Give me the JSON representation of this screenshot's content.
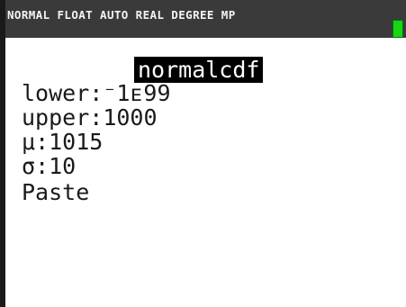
{
  "status_bar": {
    "text": "NORMAL FLOAT AUTO REAL DEGREE MP",
    "battery_color": "#16d616",
    "background_color": "#3a3a3a"
  },
  "screen": {
    "title": "normalcdf",
    "fields": [
      {
        "label": "lower",
        "separator": ":",
        "value": "⁻1ᴇ99"
      },
      {
        "label": "upper",
        "separator": ":",
        "value": "1000"
      },
      {
        "label": "μ",
        "separator": ":",
        "value": "1015"
      },
      {
        "label": "σ",
        "separator": ":",
        "value": "10"
      }
    ],
    "paste_label": "Paste"
  }
}
